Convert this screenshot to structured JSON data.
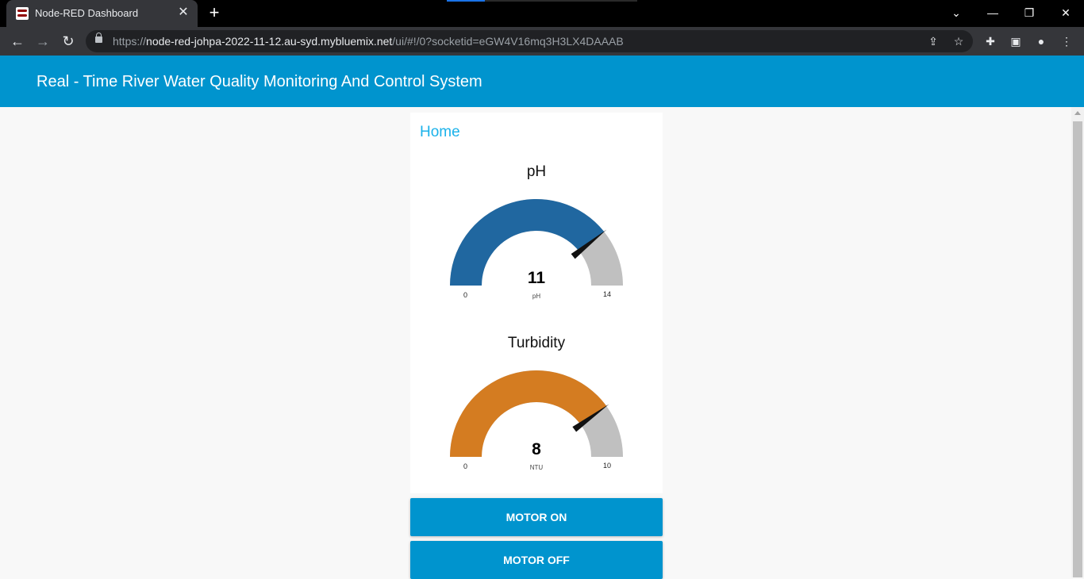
{
  "browser": {
    "tab_title": "Node-RED Dashboard",
    "url_prefix": "https://",
    "url_host": "node-red-johpa-2022-11-12.au-syd.mybluemix.net",
    "url_path": "/ui/#!/0?socketid=eGW4V16mq3H3LX4DAAAB",
    "icons": {
      "back": "arrow-left-icon",
      "forward": "arrow-right-icon",
      "reload": "reload-icon",
      "share": "share-icon",
      "bookmark": "star-icon",
      "extensions": "puzzle-icon",
      "side_panel": "side-panel-icon",
      "profile": "profile-icon",
      "menu": "kebab-menu-icon"
    }
  },
  "dashboard": {
    "title": "Real - Time River Water Quality Monitoring And Control System",
    "group_title": "Home",
    "accent_color": "#0094ce",
    "gauges": [
      {
        "title": "pH",
        "value": "11",
        "unit": "pH",
        "min": "0",
        "max": "14",
        "fraction": 0.7857,
        "color": "#2067a0"
      },
      {
        "title": "Turbidity",
        "value": "8",
        "unit": "NTU",
        "min": "0",
        "max": "10",
        "fraction": 0.8,
        "color": "#d47c21"
      }
    ],
    "buttons": {
      "motor_on": "MOTOR ON",
      "motor_off": "MOTOR OFF"
    }
  }
}
